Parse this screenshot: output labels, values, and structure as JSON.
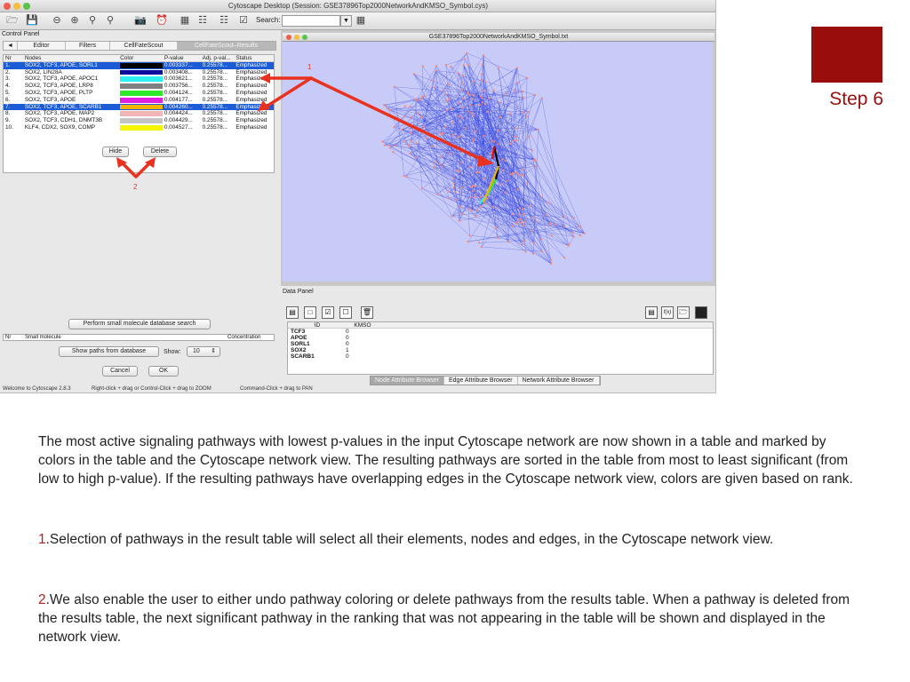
{
  "window": {
    "title": "Cytoscape Desktop (Session: GSE37896Top2000NetworkAndKMSO_Symbol.cys)",
    "traffic_colors": [
      "#f25d52",
      "#f5be3b",
      "#5ac34b"
    ]
  },
  "toolbar": {
    "search_label": "Search:",
    "icons": [
      "folder-open-icon",
      "save-icon",
      "zoom-out-icon",
      "zoom-in-icon",
      "zoom-selected-icon",
      "zoom-fit-icon",
      "camera-icon",
      "alarm-icon",
      "layout-icon",
      "network-view-icon",
      "network-new-icon",
      "check-icon"
    ]
  },
  "control_panel": {
    "title": "Control Panel",
    "tabs": [
      {
        "label": "◄"
      },
      {
        "label": "Editor"
      },
      {
        "label": "Filters"
      },
      {
        "label": "CellFateScout"
      },
      {
        "label": "CellFateScout–Results"
      }
    ],
    "table_headers": {
      "nr": "Nr",
      "nodes": "Nodes",
      "color": "Color",
      "pvalue": "P-value",
      "adj": "Adj. p-val...",
      "status": "Status"
    },
    "rows": [
      {
        "nr": "1.",
        "nodes": "SOX2, TCF3, APOE, SORL1",
        "color": "#000000",
        "pvalue": "0.003337...",
        "adj": "0.25578...",
        "status": "Emphasized",
        "selected": true
      },
      {
        "nr": "2.",
        "nodes": "SOX2, LIN28A",
        "color": "#0a0a9c",
        "pvalue": "0.003408...",
        "adj": "0.25578...",
        "status": "Emphasized",
        "selected": false
      },
      {
        "nr": "3.",
        "nodes": "SOX2, TCF3, APOE, APOC1",
        "color": "#2ff0f0",
        "pvalue": "0.003621...",
        "adj": "0.25578...",
        "status": "Emphasized",
        "selected": false
      },
      {
        "nr": "4.",
        "nodes": "SOX2, TCF3, APOE, LRP8",
        "color": "#808080",
        "pvalue": "0.003756...",
        "adj": "0.25578...",
        "status": "Emphasized",
        "selected": false
      },
      {
        "nr": "5.",
        "nodes": "SOX2, TCF3, APOE, PLTP",
        "color": "#2ee82e",
        "pvalue": "0.004124...",
        "adj": "0.25578...",
        "status": "Emphasized",
        "selected": false
      },
      {
        "nr": "6.",
        "nodes": "SOX2, TCF3, APOE",
        "color": "#e020e0",
        "pvalue": "0.004177...",
        "adj": "0.25578...",
        "status": "Emphasized",
        "selected": false
      },
      {
        "nr": "7.",
        "nodes": "SOX2, TCF3, APOE, SCARB1",
        "color": "#f2b400",
        "pvalue": "0.004260...",
        "adj": "0.25578...",
        "status": "Emphasized",
        "selected": true
      },
      {
        "nr": "8.",
        "nodes": "SOX2, TCF3, APOE, MAP2",
        "color": "#f2b6b6",
        "pvalue": "0.004424...",
        "adj": "0.25578...",
        "status": "Emphasized",
        "selected": false
      },
      {
        "nr": "9.",
        "nodes": "SOX2, TCF3, CDH1, DNMT3B",
        "color": "#c4c4c4",
        "pvalue": "0.004429...",
        "adj": "0.25578...",
        "status": "Emphasized",
        "selected": false
      },
      {
        "nr": "10.",
        "nodes": "KLF4, CDX2, SOX9, COMP",
        "color": "#f5f500",
        "pvalue": "0.004527...",
        "adj": "0.25578...",
        "status": "Emphasized",
        "selected": false
      }
    ],
    "hide_label": "Hide",
    "delete_label": "Delete",
    "search_db_label": "Perform small molecule database search",
    "sm_headers": {
      "nr": "Nr",
      "small": "Small molecule",
      "conc": "Concentration"
    },
    "show_paths_label": "Show paths from database",
    "show_label": "Show:",
    "show_value": "10",
    "cancel_label": "Cancel",
    "ok_label": "OK"
  },
  "network": {
    "title": "GSE37896Top2000NetworkAndKMSO_Symbol.txt",
    "bg_color": "#c8cbf7",
    "edge_color": "#3344dd",
    "node_color": "#f08a80"
  },
  "data_panel": {
    "title": "Data Panel",
    "headers": {
      "id": "ID",
      "kmso": "KMSO"
    },
    "rows": [
      {
        "id": "TCF3",
        "kmso": "0"
      },
      {
        "id": "APOE",
        "kmso": "0"
      },
      {
        "id": "SORL1",
        "kmso": "0"
      },
      {
        "id": "SOX2",
        "kmso": "1"
      },
      {
        "id": "SCARB1",
        "kmso": "0"
      }
    ],
    "tabs": [
      {
        "label": "Node Attribute Browser",
        "active": true
      },
      {
        "label": "Edge Attribute Browser",
        "active": false
      },
      {
        "label": "Network Attribute Browser",
        "active": false
      }
    ]
  },
  "statusbar": {
    "welcome": "Welcome to Cytoscape 2.8.3",
    "hint_zoom": "Right-click + drag or Control-Click + drag to ZOOM",
    "hint_pan": "Command-Click + drag to PAN"
  },
  "annotations": {
    "label_1": "1",
    "label_2": "2",
    "color": "#e8321f"
  },
  "slide": {
    "step_label": "Step 6",
    "step_color": "#9a0d0d",
    "paragraph_main": "The most active signaling pathways with lowest p-values in the input Cytoscape network are now shown in a table and marked by colors in the table and the Cytoscape network view. The resulting pathways are sorted in the table from most to least significant (from low to high p-value). If the resulting pathways have overlapping edges in the Cytoscape network view, colors are given based on rank.",
    "point_1_num": "1",
    "point_1_text": ".Selection of pathways in the result table will select all their elements, nodes and edges, in the Cytoscape network view.",
    "point_2_num": "2",
    "point_2_text": ".We also enable the user to either undo pathway coloring or delete pathways from the results table. When a pathway is deleted from the results table, the next significant pathway in the ranking that was not appearing in the table will be shown and displayed in the network view."
  }
}
